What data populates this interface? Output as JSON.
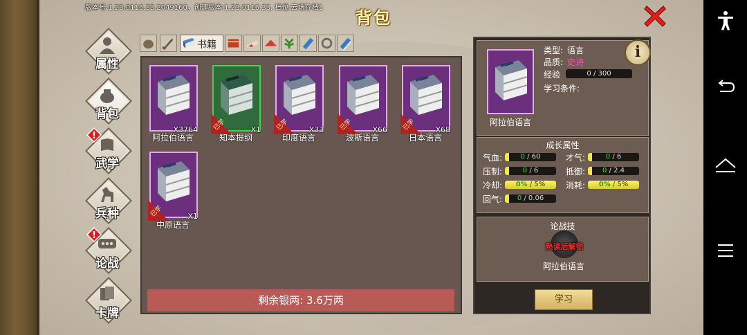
{
  "header": {
    "version_text": "版本号:1.23.0116.33.2049160，创建版本:1.23.0116.33, 档位:云端存档1",
    "title": "背包"
  },
  "sidebar": [
    {
      "label": "属性",
      "icon": "person-icon",
      "alert": false
    },
    {
      "label": "背包",
      "icon": "bag-icon",
      "alert": false,
      "active": true
    },
    {
      "label": "武学",
      "icon": "book-icon",
      "alert": true
    },
    {
      "label": "兵种",
      "icon": "horse-icon",
      "alert": false
    },
    {
      "label": "论战",
      "icon": "speech-bubble-icon",
      "alert": true
    },
    {
      "label": "卡牌",
      "icon": "cards-icon",
      "alert": false
    }
  ],
  "tabs": {
    "active_label": "书籍",
    "icons": [
      "pouch-icon",
      "sword-icon",
      "book-tab-icon",
      "scroll-icon",
      "cloth-icon",
      "hat-icon",
      "herb-icon",
      "blue-book-icon",
      "rope-icon",
      "blue-book-2-icon"
    ]
  },
  "items": [
    {
      "name": "阿拉伯语言",
      "qty": "X3764",
      "rarity": "purple",
      "learned_tag": ""
    },
    {
      "name": "知本提纲",
      "qty": "X1",
      "rarity": "green",
      "learned_tag": "已学"
    },
    {
      "name": "印度语言",
      "qty": "X33",
      "rarity": "purple",
      "learned_tag": "已学"
    },
    {
      "name": "波斯语言",
      "qty": "X66",
      "rarity": "purple",
      "learned_tag": "已学"
    },
    {
      "name": "日本语言",
      "qty": "X68",
      "rarity": "purple",
      "learned_tag": "已学"
    },
    {
      "name": "中原语言",
      "qty": "X1",
      "rarity": "purple",
      "learned_tag": "已学"
    }
  ],
  "footer": {
    "silver_text": "剩余银两: 3.6万两"
  },
  "detail": {
    "name": "阿拉伯语言",
    "type_label": "类型:",
    "type_value": "语言",
    "quality_label": "品质:",
    "quality_value": "史诗",
    "exp_label": "经验",
    "exp_value": "0 / 300",
    "req_label": "学习条件:",
    "info_symbol": "i",
    "growth_title": "成长属性",
    "stats": [
      {
        "label": "气血:",
        "cur": "0",
        "max": " / 60",
        "full": false
      },
      {
        "label": "才气:",
        "cur": "0",
        "max": " / 6",
        "full": false
      },
      {
        "label": "压制:",
        "cur": "0",
        "max": " / 6",
        "full": false
      },
      {
        "label": "抵御:",
        "cur": "0",
        "max": " / 2.4",
        "full": false
      },
      {
        "label": "冷却:",
        "cur": "0%",
        "max": " / 5%",
        "full": true
      },
      {
        "label": "消耗:",
        "cur": "0%",
        "max": " / 5%",
        "full": true
      },
      {
        "label": "回气:",
        "cur": "0",
        "max": " / 0.06",
        "full": false
      }
    ],
    "skill_title": "论战技",
    "skill_lock_text": "熟读后解锁",
    "skill_name": "阿拉伯语言",
    "learn_button": "学习"
  },
  "colors": {
    "epic": "#ff4fb0",
    "purple_frame": "#e8a8f0",
    "green_frame": "#46d046",
    "silver_bar": "#b85a55"
  },
  "system_nav": [
    "accessibility-icon",
    "back-icon",
    "home-icon",
    "menu-icon"
  ]
}
